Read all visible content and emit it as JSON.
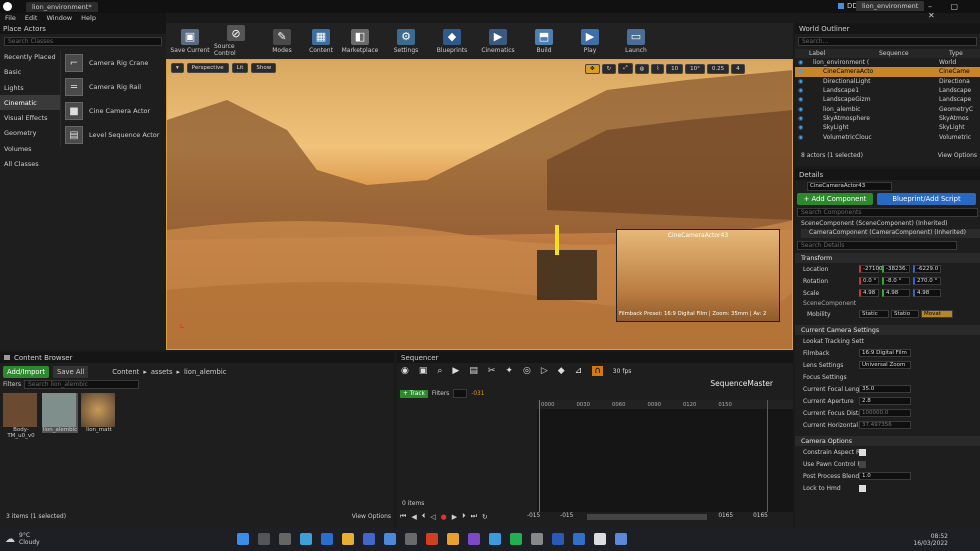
{
  "app": {
    "tab_title": "lion_environment*",
    "project": "DDC",
    "level": "lion_environment"
  },
  "menu": [
    "File",
    "Edit",
    "Window",
    "Help"
  ],
  "place_actors": {
    "tab": "Place Actors",
    "search_placeholder": "Search Classes",
    "categories": [
      "Recently Placed",
      "Basic",
      "Lights",
      "Cinematic",
      "Visual Effects",
      "Geometry",
      "Volumes",
      "All Classes"
    ],
    "actors": [
      "Camera Rig Crane",
      "Camera Rig Rail",
      "Cine Camera Actor",
      "Level Sequence Actor"
    ]
  },
  "toolbar": [
    "Save Current",
    "Source Control",
    "Modes",
    "Content",
    "Marketplace",
    "Settings",
    "Blueprints",
    "Cinematics",
    "Build",
    "Play",
    "Launch"
  ],
  "viewport": {
    "perspective": "Perspective",
    "lit": "Lit",
    "show": "Show",
    "grid": "10",
    "angle": "10°",
    "scale": "0.25",
    "cam_speed": "4",
    "pip_title": "CineCameraActor43",
    "pip_overlay": "Filmback Preset: 16:9 Digital Film | Zoom: 35mm | Av: 2"
  },
  "outliner": {
    "tab": "World Outliner",
    "search_placeholder": "Search...",
    "headers": [
      "Label",
      "Sequence",
      "Type"
    ],
    "rows": [
      {
        "label": "lion_environment (",
        "type": "World"
      },
      {
        "label": "CineCameraActo",
        "type": "CineCame"
      },
      {
        "label": "DirectionalLight",
        "type": "Directiona"
      },
      {
        "label": "Landscape1",
        "type": "Landscape"
      },
      {
        "label": "LandscapeGizm",
        "type": "Landscape"
      },
      {
        "label": "lion_alembic",
        "type": "GeometryC"
      },
      {
        "label": "SkyAtmosphere",
        "type": "SkyAtmos"
      },
      {
        "label": "SkyLight",
        "type": "SkyLight"
      },
      {
        "label": "VolumetricClouc",
        "type": "Volumetric"
      }
    ],
    "count": "8 actors (1 selected)",
    "view_options": "View Options"
  },
  "details": {
    "tab": "Details",
    "actor_name": "CineCameraActor43",
    "add_component": "+ Add Component",
    "blueprint": "Blueprint/Add Script",
    "search_components": "Search Components",
    "components": [
      "SceneComponent (SceneComponent) (Inherited)",
      "CameraComponent (CameraComponent) (Inherited)"
    ],
    "search_details": "Search Details",
    "transform": "Transform",
    "location_label": "Location",
    "location": [
      "-27100.",
      "-38236.",
      "-6229.0"
    ],
    "rotation_label": "Rotation",
    "rotation": [
      "0.0 °",
      "-8.0 °",
      "270.0 °"
    ],
    "scale_label": "Scale",
    "scale": [
      "4.98",
      "4.98",
      "4.98"
    ],
    "scene_component": "SceneComponent",
    "mobility_label": "Mobility",
    "mobility": [
      "Static",
      "Statio",
      "Movat"
    ],
    "camera_settings": "Current Camera Settings",
    "lookat": "Lookat Tracking Sett",
    "filmback_label": "Filmback",
    "filmback": "16:9 Digital Film",
    "lens_label": "Lens Settings",
    "lens": "Universal Zoom",
    "focus_settings": "Focus Settings",
    "focal_label": "Current Focal Lengt",
    "focal": "35.0",
    "aperture_label": "Current Aperture",
    "aperture": "2.8",
    "focus_dist_label": "Current Focus Distan",
    "focus_dist": "100000.0",
    "hfov_label": "Current Horizontal Fl",
    "hfov": "37.497356",
    "camera_options": "Camera Options",
    "opt1": "Constrain Aspect Ra",
    "opt2": "Use Pawn Control Ro",
    "opt3_label": "Post Process Blend",
    "opt3": "1.0",
    "opt4": "Lock to Hmd"
  },
  "content_browser": {
    "tab": "Content Browser",
    "add_import": "Add/Import",
    "save_all": "Save All",
    "path": [
      "Content",
      "assets",
      "lion_alembic"
    ],
    "filters": "Filters",
    "search_placeholder": "Search lion_alembic",
    "assets": [
      "Body-TM_u0_v0",
      "lion_alembic",
      "lion_matt"
    ],
    "count": "3 items (1 selected)",
    "view_options": "View Options"
  },
  "sequencer": {
    "tab": "Sequencer",
    "fps": "30 fps",
    "name": "SequenceMaster",
    "track": "+ Track",
    "filters": "Filters",
    "frame": "-031",
    "ticks": [
      "0000",
      "0030",
      "0060",
      "0090",
      "0120",
      "0150"
    ],
    "items": "0 items",
    "start1": "-015",
    "start2": "-015",
    "end1": "0165",
    "end2": "0165"
  },
  "taskbar": {
    "temp": "9°C",
    "weather": "Cloudy",
    "time": "08:52",
    "date": "16/03/2022"
  }
}
